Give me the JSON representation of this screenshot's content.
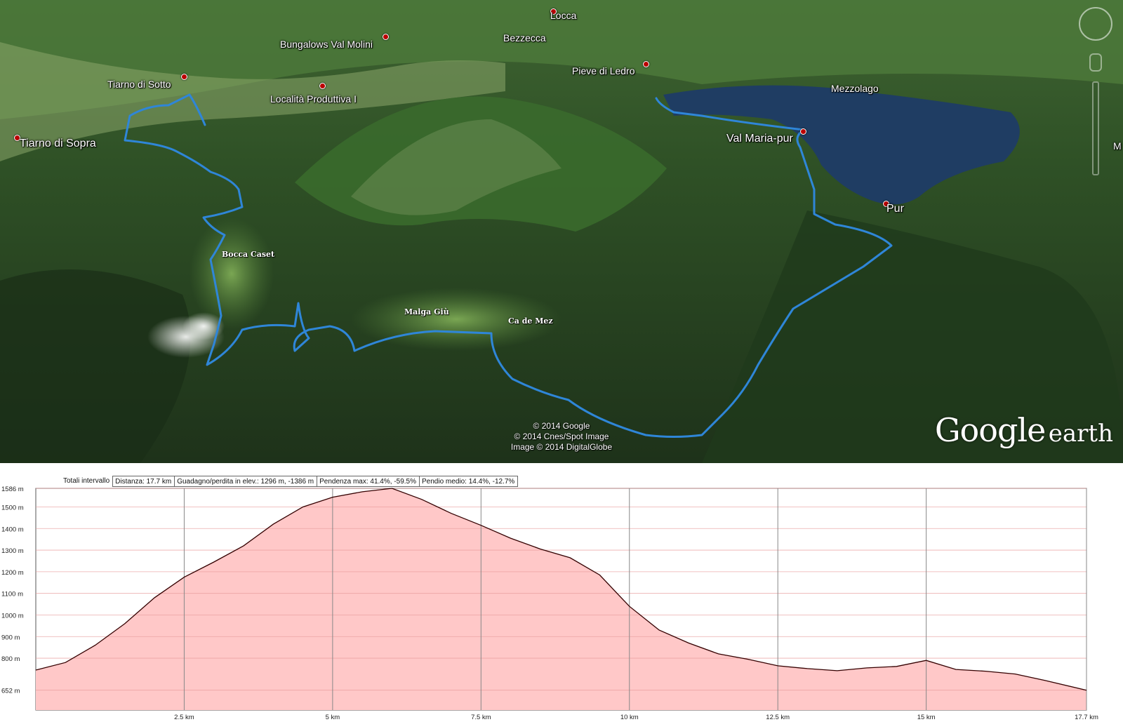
{
  "map": {
    "places": [
      {
        "name": "Locca",
        "cls": "place"
      },
      {
        "name": "Bezzecca",
        "cls": "place"
      },
      {
        "name": "Bungalows Val Molini",
        "cls": "place"
      },
      {
        "name": "Pieve di Ledro",
        "cls": "place"
      },
      {
        "name": "Tiarno di Sotto",
        "cls": "place"
      },
      {
        "name": "Località Produttiva I",
        "cls": "place"
      },
      {
        "name": "Mezzolago",
        "cls": "place"
      },
      {
        "name": "Tiarno di Sopra",
        "cls": "place big"
      },
      {
        "name": "Val Maria-pur",
        "cls": "place big"
      },
      {
        "name": "Pur",
        "cls": "place big"
      },
      {
        "name": "M",
        "cls": "place"
      }
    ],
    "waypoints": [
      "Bocca Caset",
      "Malga Giù",
      "Ca de Mez"
    ],
    "copyright": [
      "© 2014 Google",
      "© 2014 Cnes/Spot Image",
      "Image © 2014 DigitalGlobe"
    ],
    "logo_main": "Google",
    "logo_sub": "earth",
    "track_color": "#2f86d8",
    "lake_color": "#1f3d63"
  },
  "profile": {
    "stats_label": "Totali intervallo",
    "stats": [
      "Distanza: 17.7 km",
      "Guadagno/perdita in elev.: 1296 m, -1386 m",
      "Pendenza max: 41.4%, -59.5%",
      "Pendio medio: 14.4%, -12.7%"
    ]
  },
  "chart_data": {
    "type": "area",
    "title": "",
    "xlabel": "",
    "ylabel": "",
    "xlim": [
      0,
      17.7
    ],
    "ylim": [
      560,
      1586
    ],
    "x_ticks": [
      2.5,
      5,
      7.5,
      10,
      12.5,
      15,
      17.7
    ],
    "x_tick_labels": [
      "2.5 km",
      "5 km",
      "7.5 km",
      "10 km",
      "12.5 km",
      "15 km",
      "17.7 km"
    ],
    "y_ticks": [
      652,
      800,
      900,
      1000,
      1100,
      1200,
      1300,
      1400,
      1500,
      1586
    ],
    "y_tick_labels": [
      "652 m",
      "800 m",
      "900 m",
      "1000 m",
      "1100 m",
      "1200 m",
      "1300 m",
      "1400 m",
      "1500 m",
      "1586 m"
    ],
    "grid": true,
    "fill_color": "#ffc8c8",
    "line_color": "#330000",
    "series": [
      {
        "x": [
          0,
          0.5,
          1,
          1.5,
          2,
          2.5,
          3,
          3.5,
          4,
          4.5,
          5,
          5.5,
          6,
          6.5,
          7,
          7.5,
          8,
          8.5,
          9,
          9.5,
          10,
          10.5,
          11,
          11.5,
          12,
          12.5,
          13,
          13.5,
          14,
          14.5,
          15,
          15.5,
          16,
          16.5,
          17,
          17.7
        ],
        "values": [
          745,
          780,
          860,
          960,
          1080,
          1175,
          1245,
          1320,
          1420,
          1500,
          1545,
          1570,
          1586,
          1535,
          1470,
          1415,
          1355,
          1305,
          1265,
          1185,
          1040,
          930,
          870,
          820,
          795,
          765,
          752,
          742,
          755,
          762,
          790,
          748,
          740,
          727,
          697,
          652
        ]
      }
    ]
  }
}
